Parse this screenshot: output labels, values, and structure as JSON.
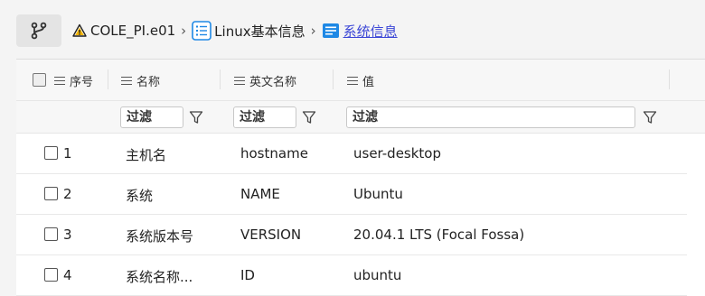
{
  "breadcrumb": {
    "connection": "COLE_PI.e01",
    "separator": "›",
    "category": "Linux基本信息",
    "current": "系统信息"
  },
  "table": {
    "columns": [
      "序号",
      "名称",
      "英文名称",
      "值"
    ],
    "filter_placeholder": "过滤",
    "rows": [
      {
        "index": "1",
        "name": "主机名",
        "english": "hostname",
        "value": "user-desktop"
      },
      {
        "index": "2",
        "name": "系统",
        "english": "NAME",
        "value": "Ubuntu"
      },
      {
        "index": "3",
        "name": "系统版本号",
        "english": "VERSION",
        "value": "20.04.1 LTS (Focal Fossa)"
      },
      {
        "index": "4",
        "name": "系统名称...",
        "english": "ID",
        "value": "ubuntu"
      }
    ]
  },
  "colors": {
    "link": "#3b46d6",
    "accent_icon": "#1e88e5",
    "warning_icon": "#f2b300"
  }
}
